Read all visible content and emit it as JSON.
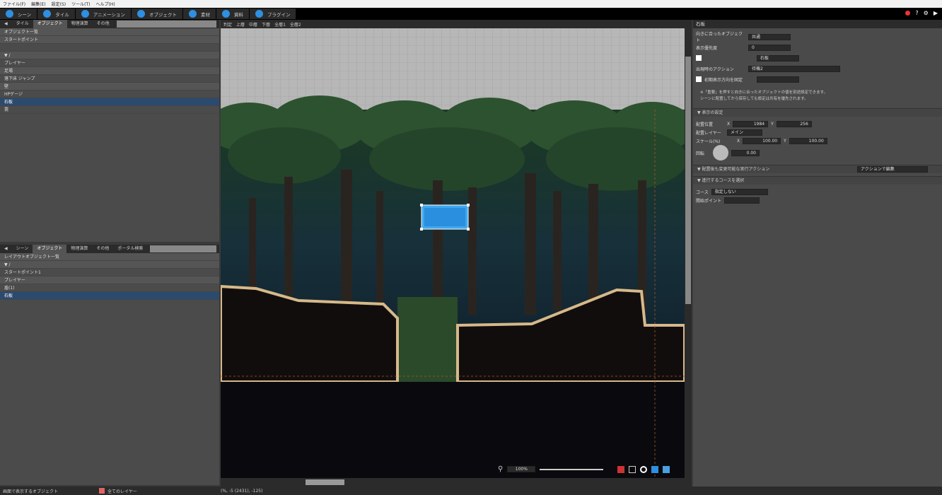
{
  "menubar": [
    "ファイル(F)",
    "編集(E)",
    "設定(S)",
    "ツール(T)",
    "ヘルプ(H)"
  ],
  "toptabs": [
    {
      "label": "シーン",
      "icon": "scene-icon"
    },
    {
      "label": "タイル",
      "icon": "tile-icon"
    },
    {
      "label": "アニメーション",
      "icon": "animation-icon"
    },
    {
      "label": "オブジェクト",
      "icon": "object-icon"
    },
    {
      "label": "素材",
      "icon": "asset-icon"
    },
    {
      "label": "資料",
      "icon": "resource-icon"
    },
    {
      "label": "プラグイン",
      "icon": "plugin-icon"
    }
  ],
  "colors": {
    "accent": "#2f8fe0",
    "selected": "#2b4a70",
    "canvas_dark": "#0a0a0e"
  },
  "left_top": {
    "tabs": [
      "タイル",
      "オブジェクト",
      "物理演算",
      "その他"
    ],
    "tree": [
      {
        "label": "オブジェクト一覧",
        "state": "header"
      },
      {
        "label": "スタートポイント",
        "state": "alt"
      },
      {
        "label": "",
        "state": "normal"
      },
      {
        "label": "▼ /",
        "state": "alt"
      },
      {
        "label": "プレイヤー",
        "state": "normal"
      },
      {
        "label": "足場",
        "state": "alt"
      },
      {
        "label": "落下床 ジャンプ",
        "state": "normal"
      },
      {
        "label": "壁",
        "state": "alt"
      },
      {
        "label": "HPゲージ",
        "state": "normal"
      },
      {
        "label": "石板",
        "state": "sel"
      },
      {
        "label": "罠",
        "state": "normal"
      }
    ]
  },
  "left_bottom": {
    "tabs": [
      "シーン",
      "オブジェクト",
      "物理演算",
      "その他",
      "ポータル検索"
    ],
    "tree": [
      {
        "label": "レイアウトオブジェクト一覧",
        "state": "header"
      },
      {
        "label": "▼ /",
        "state": "alt"
      },
      {
        "label": "スタートポイント1",
        "state": "normal"
      },
      {
        "label": "プレイヤー",
        "state": "alt"
      },
      {
        "label": "盾(1)",
        "state": "normal"
      },
      {
        "label": "石板",
        "state": "sel"
      }
    ]
  },
  "statusbar": {
    "left": "画面で表示するオブジェクト",
    "layer": "全てのレイヤー",
    "coords": "(%, -5 (2431), -125)"
  },
  "canvas_toolbar": [
    "判定",
    "上層",
    "中層",
    "下層",
    "全層1",
    "全層2"
  ],
  "zoom": {
    "value": "100%"
  },
  "right": {
    "title": "石板",
    "props": [
      {
        "label": "向きに合ったオブジェクト",
        "value": "共通"
      },
      {
        "label": "表示優先度",
        "value": "0"
      },
      {
        "label": "",
        "value": "石板"
      },
      {
        "label": "出現時のアクション",
        "value": "待機2"
      },
      {
        "label": "初期表示方向を固定",
        "value": ""
      }
    ],
    "note1": "※「重要」を押すと向きに合ったオブジェクトの値を別途設定できます。",
    "note2": "シーンに配置してから保存しても設定は共有を優先されます。",
    "section_display": "表示の設定",
    "pos_label": "配置位置",
    "pos_x": "1984",
    "pos_y": "256",
    "layer_label": "配置レイヤー",
    "layer_value": "メイン",
    "scale_label": "スケール(%)",
    "scale_x": "100.00",
    "scale_y": "100.00",
    "rot_label": "回転",
    "rot_value": "0.00",
    "section_action": "配置後も変更可能な実行アクション",
    "action_btn": "アクションで編集",
    "section_course": "進行するコースを選択",
    "course_label": "コース",
    "course_value": "指定しない",
    "start_label": "開始ポイント",
    "x_label": "X",
    "y_label": "Y"
  }
}
